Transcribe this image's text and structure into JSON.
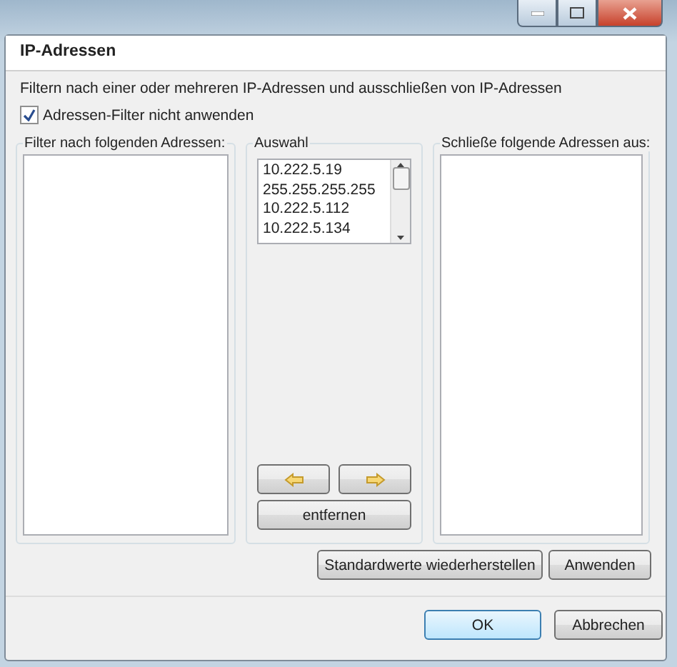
{
  "dialog": {
    "title": "IP-Adressen",
    "description": "Filtern nach einer oder mehreren IP-Adressen und ausschließen von IP-Adressen",
    "checkbox": {
      "label": "Adressen-Filter nicht anwenden",
      "checked": true
    }
  },
  "groups": [
    {
      "kind": "list",
      "title": "Filter nach folgenden Adressen:"
    },
    {
      "kind": "picker",
      "title": "Auswahl",
      "items": [
        "10.222.5.19",
        "255.255.255.255",
        "10.222.5.112",
        "10.222.5.134"
      ],
      "remove_button": "entfernen"
    },
    {
      "kind": "list",
      "title": "Schließe folgende Adressen aus:"
    }
  ],
  "actions": [
    "Standardwerte wiederherstellen",
    "Anwenden"
  ],
  "buttons": [
    {
      "label": "OK",
      "default": true
    },
    {
      "label": "Abbrechen",
      "default": false
    }
  ]
}
